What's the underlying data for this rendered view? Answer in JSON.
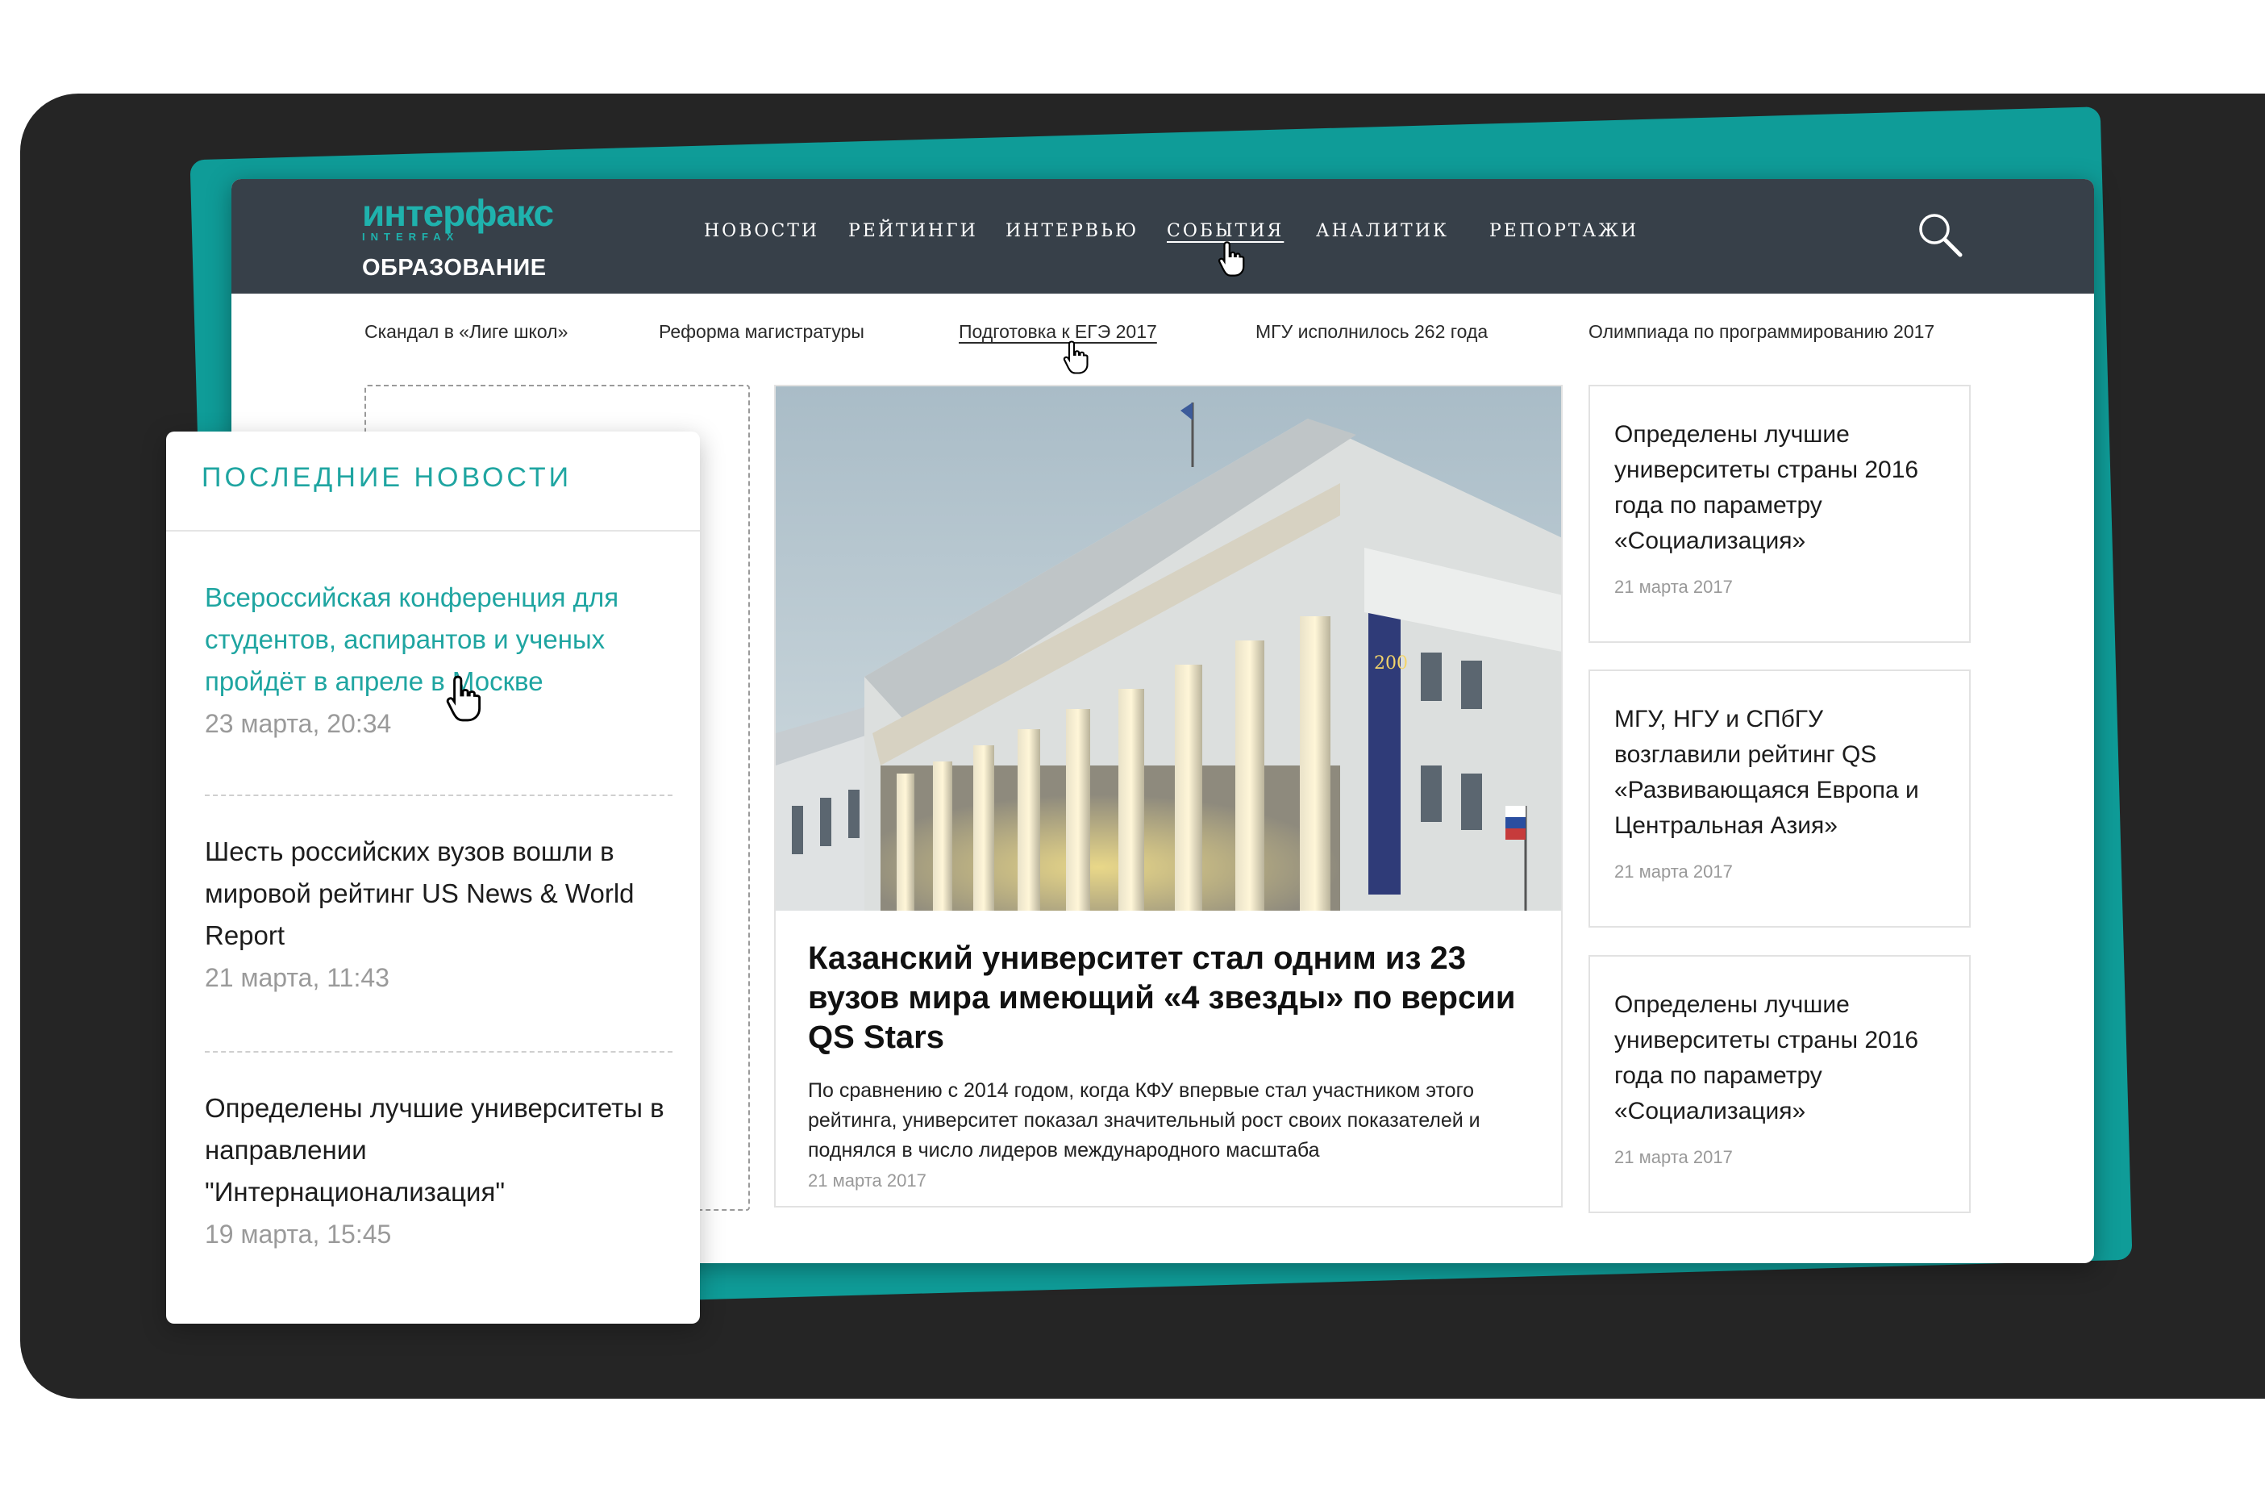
{
  "logo": {
    "brand": "интерфакс",
    "brand_latin": "INTERFAX",
    "section": "ОБРАЗОВАНИЕ"
  },
  "nav": {
    "items": [
      "НОВОСТИ",
      "РЕЙТИНГИ",
      "ИНТЕРВЬЮ",
      "СОБЫТИЯ",
      "АНАЛИТИК",
      "РЕПОРТАЖИ"
    ],
    "active": "СОБЫТИЯ"
  },
  "subnav": {
    "items": [
      "Скандал в «Лиге школ»",
      "Реформа магистратуры",
      "Подготовка к ЕГЭ 2017",
      "МГУ исполнилось 262 года",
      "Олимпиада по программированию 2017"
    ],
    "active": "Подготовка к ЕГЭ 2017"
  },
  "main_article": {
    "title": "Казанский университет стал одним из 23 вузов мира имеющий «4 звезды» по версии QS Stars",
    "lead": "По сравнению с 2014 годом, когда КФУ впервые стал участником этого рейтинга, университет показал значительный рост своих показателей и поднялся в число лидеров международного масштаба",
    "date": "21 марта 2017"
  },
  "side_articles": [
    {
      "title": "Определены лучшие университеты страны 2016 года по параметру «Социализация»",
      "date": "21 марта 2017"
    },
    {
      "title": "МГУ, НГУ и СПбГУ возглавили рейтинг QS «Развивающаяся Европа и Центральная Азия»",
      "date": "21 марта 2017"
    },
    {
      "title": "Определены лучшие университеты страны 2016 года по параметру «Социализация»",
      "date": "21 марта 2017"
    }
  ],
  "latest_news": {
    "title": "ПОСЛЕДНИЕ НОВОСТИ",
    "items": [
      {
        "title": "Всероссийская конференция для студентов, аспирантов и ученых пройдёт в апреле в Москве",
        "date": "23 марта, 20:34"
      },
      {
        "title": "Шесть российских вузов вошли в мировой рейтинг US News & World Report",
        "date": "21 марта, 11:43"
      },
      {
        "title": "Определены лучшие университеты в направлении \"Интернационализация\"",
        "date": "19 марта, 15:45"
      }
    ]
  },
  "colors": {
    "accent": "#1fa5a1",
    "header_bg": "#374049",
    "stage_bg": "#252525"
  },
  "icons": [
    "search-icon",
    "hand-cursor-icon"
  ]
}
